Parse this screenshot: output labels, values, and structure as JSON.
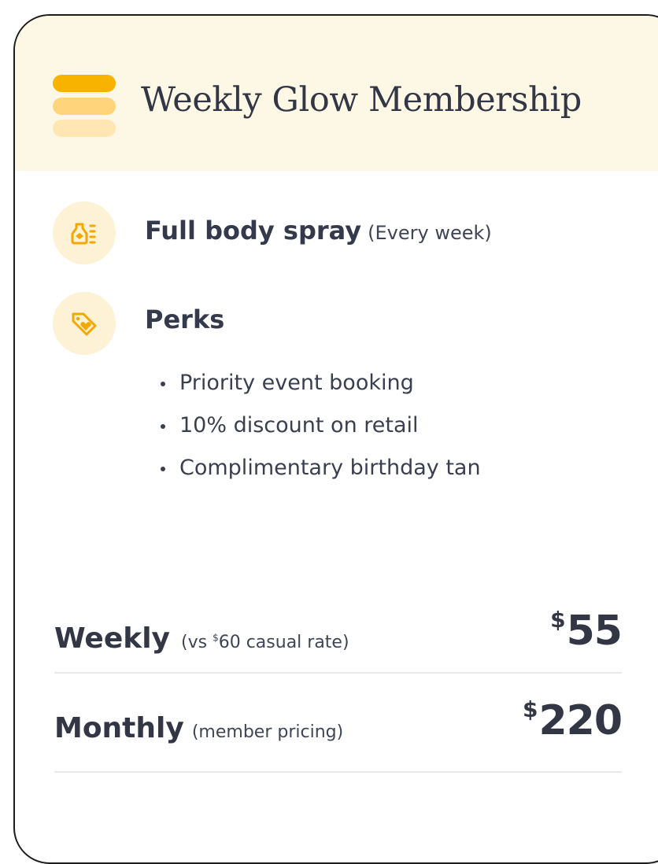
{
  "header": {
    "title": "Weekly Glow Membership",
    "logo_icon": "stacked-bars-icon",
    "background": "#fdf7e5"
  },
  "features": [
    {
      "icon": "spray-bottle-icon",
      "title": "Full body spray",
      "subtitle": "(Every week)"
    },
    {
      "icon": "heart-tag-icon",
      "title": "Perks",
      "subtitle": ""
    }
  ],
  "perks": [
    "Priority event booking",
    "10% discount on retail",
    "Complimentary birthday tan"
  ],
  "pricing": {
    "weekly": {
      "label": "Weekly",
      "note_prefix": "(vs ",
      "note_currency": "$",
      "note_amount": "60 casual rate)",
      "currency": "$",
      "amount": "55"
    },
    "monthly": {
      "label": "Monthly",
      "note": "(member pricing)",
      "currency": "$",
      "amount": "220"
    }
  },
  "colors": {
    "accent": "#f8b200",
    "accent_light": "#ffd47a",
    "accent_pale": "#ffe6b2",
    "icon_bg": "#fdf1d6",
    "text": "#343a4c"
  }
}
